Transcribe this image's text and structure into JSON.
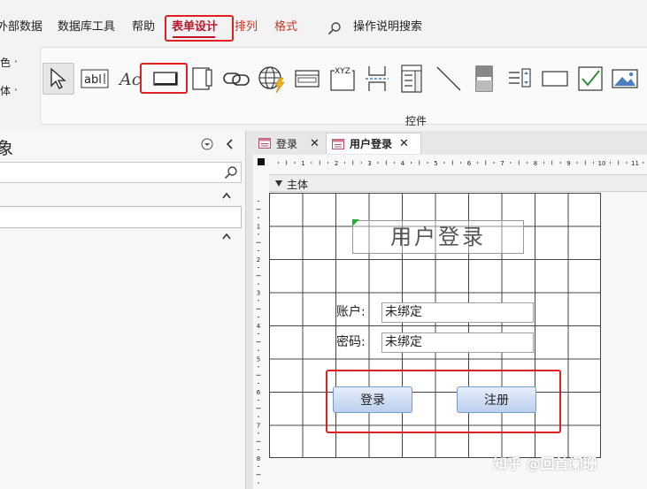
{
  "menu": {
    "items": [
      {
        "label": "外部数据",
        "style": "normal"
      },
      {
        "label": "数据库工具",
        "style": "normal"
      },
      {
        "label": "帮助",
        "style": "normal"
      },
      {
        "label": "表单设计",
        "style": "active"
      },
      {
        "label": "排列",
        "style": "red"
      },
      {
        "label": "格式",
        "style": "red"
      }
    ],
    "search_label": "操作说明搜索",
    "search_icon": "search-icon"
  },
  "ribbon": {
    "left_items": [
      {
        "label": "色",
        "icon": "chevron-down-icon"
      },
      {
        "label": "体",
        "icon": "chevron-down-icon"
      }
    ],
    "tools": [
      {
        "name": "select-tool",
        "icon": "pointer-icon",
        "selected": true
      },
      {
        "name": "textbox-tool",
        "icon": "textbox-icon",
        "text": "abl"
      },
      {
        "name": "label-tool",
        "icon": "label-icon",
        "text": "Ac"
      },
      {
        "name": "button-tool",
        "icon": "button-icon",
        "highlighted": true
      },
      {
        "name": "tab-control-tool",
        "icon": "tab-control-icon"
      },
      {
        "name": "hyperlink-tool",
        "icon": "link-icon"
      },
      {
        "name": "web-browser-tool",
        "icon": "globe-icon"
      },
      {
        "name": "navigation-tool",
        "icon": "navigation-control-icon"
      },
      {
        "name": "option-group-tool",
        "icon": "option-group-icon",
        "text": "XYZ"
      },
      {
        "name": "page-break-tool",
        "icon": "page-break-icon"
      },
      {
        "name": "combo-box-tool",
        "icon": "combo-box-icon"
      },
      {
        "name": "line-tool",
        "icon": "line-icon"
      },
      {
        "name": "toggle-button-tool",
        "icon": "toggle-icon"
      },
      {
        "name": "list-box-tool",
        "icon": "list-box-icon"
      },
      {
        "name": "rectangle-tool",
        "icon": "rectangle-icon"
      },
      {
        "name": "checkbox-tool",
        "icon": "checkbox-icon"
      },
      {
        "name": "image-tool",
        "icon": "image-icon"
      }
    ],
    "group_label": "控件"
  },
  "nav": {
    "title": "象",
    "collapse_icon": "chevron-left-icon",
    "menu_icon": "circle-chevron-down-icon",
    "search_icon": "search-icon",
    "group_icon": "chevron-up-icon"
  },
  "tabs": [
    {
      "label": "登录",
      "active": false,
      "icon": "form-icon",
      "close": "✕"
    },
    {
      "label": "用户登录",
      "active": true,
      "icon": "form-icon",
      "close": "✕"
    }
  ],
  "ruler": {
    "h_numbers": [
      "1",
      "2",
      "3",
      "4",
      "5",
      "6",
      "7",
      "8",
      "9",
      "10",
      "11"
    ],
    "v_numbers": [
      "1",
      "2",
      "3",
      "4",
      "5",
      "6",
      "7",
      "8"
    ]
  },
  "section": {
    "label": "主体",
    "icon": "down-arrow-icon"
  },
  "form": {
    "title": "用户登录",
    "fields": [
      {
        "label": "账户:",
        "value": "未绑定"
      },
      {
        "label": "密码:",
        "value": "未绑定"
      }
    ],
    "buttons": [
      "登录",
      "注册"
    ]
  },
  "watermark": "知乎 @回首阑珊",
  "colors": {
    "accent": "#b8152c",
    "highlight": "#e02020",
    "button": "#bccfee"
  }
}
